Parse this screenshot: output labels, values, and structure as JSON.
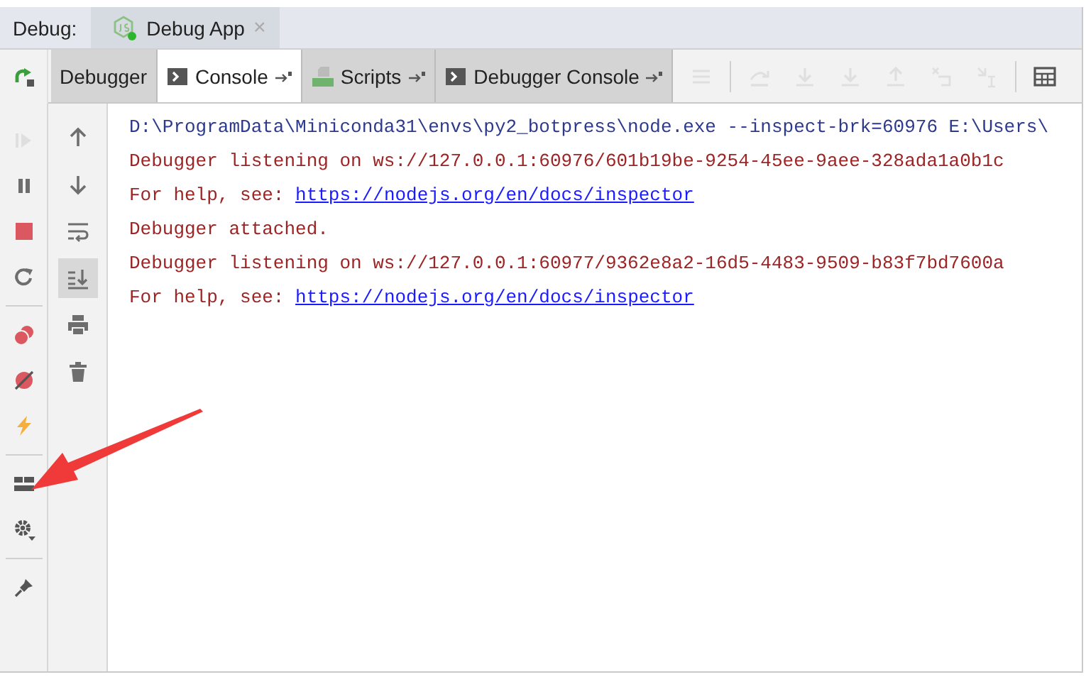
{
  "header": {
    "label": "Debug:",
    "tabs": [
      {
        "title": "Debug App",
        "selected": true,
        "close": "×"
      }
    ]
  },
  "rerun": {
    "kind": "rerun",
    "disabled": false
  },
  "tabs": [
    {
      "label": "Debugger",
      "selected": false,
      "kind": "plain"
    },
    {
      "label": "Console",
      "selected": true,
      "kind": "console"
    },
    {
      "label": "Scripts",
      "selected": false,
      "kind": "scripts"
    },
    {
      "label": "Debugger Console",
      "selected": false,
      "kind": "console"
    }
  ],
  "toolbar": [
    {
      "kind": "menu",
      "disabled": true
    },
    {
      "kind": "divider"
    },
    {
      "kind": "step-over",
      "disabled": true
    },
    {
      "kind": "step-into",
      "disabled": true
    },
    {
      "kind": "force-step-into",
      "disabled": true
    },
    {
      "kind": "step-out",
      "disabled": true
    },
    {
      "kind": "drop-frame",
      "disabled": true
    },
    {
      "kind": "run-to-cursor",
      "disabled": true
    },
    {
      "kind": "divider"
    },
    {
      "kind": "evaluate",
      "disabled": false
    }
  ],
  "debug_tools": [
    [
      {
        "kind": "resume",
        "disabled": true
      },
      {
        "kind": "pause",
        "disabled": false
      },
      {
        "kind": "stop",
        "disabled": false
      },
      {
        "kind": "restart",
        "disabled": false
      }
    ],
    [
      {
        "kind": "breakpoints",
        "disabled": false
      },
      {
        "kind": "mute",
        "disabled": false
      },
      {
        "kind": "lightning",
        "disabled": false
      }
    ],
    [
      {
        "kind": "layout",
        "disabled": false
      },
      {
        "kind": "gear",
        "disabled": false
      }
    ],
    [
      {
        "kind": "pin",
        "disabled": false
      }
    ]
  ],
  "console_tools": [
    {
      "kind": "up",
      "selected": false
    },
    {
      "kind": "down",
      "selected": false
    },
    {
      "kind": "wrap",
      "selected": false
    },
    {
      "kind": "scroll-end",
      "selected": true
    },
    {
      "kind": "print",
      "selected": false
    },
    {
      "kind": "trash",
      "selected": false
    }
  ],
  "console": [
    {
      "kind": "command",
      "text": "D:\\ProgramData\\Miniconda31\\envs\\py2_botpress\\node.exe --inspect-brk=60976 E:\\Users\\"
    },
    {
      "kind": "output",
      "text": "Debugger listening on ws://127.0.0.1:60976/601b19be-9254-45ee-9aee-328ada1a0b1c"
    },
    {
      "kind": "output",
      "text": "For help, see: ",
      "link": "https://nodejs.org/en/docs/inspector"
    },
    {
      "kind": "output",
      "text": "Debugger attached."
    },
    {
      "kind": "output",
      "text": "Debugger listening on ws://127.0.0.1:60977/9362e8a2-16d5-4483-9509-b83f7bd7600a"
    },
    {
      "kind": "output",
      "text": "For help, see: ",
      "link": "https://nodejs.org/en/docs/inspector"
    }
  ]
}
